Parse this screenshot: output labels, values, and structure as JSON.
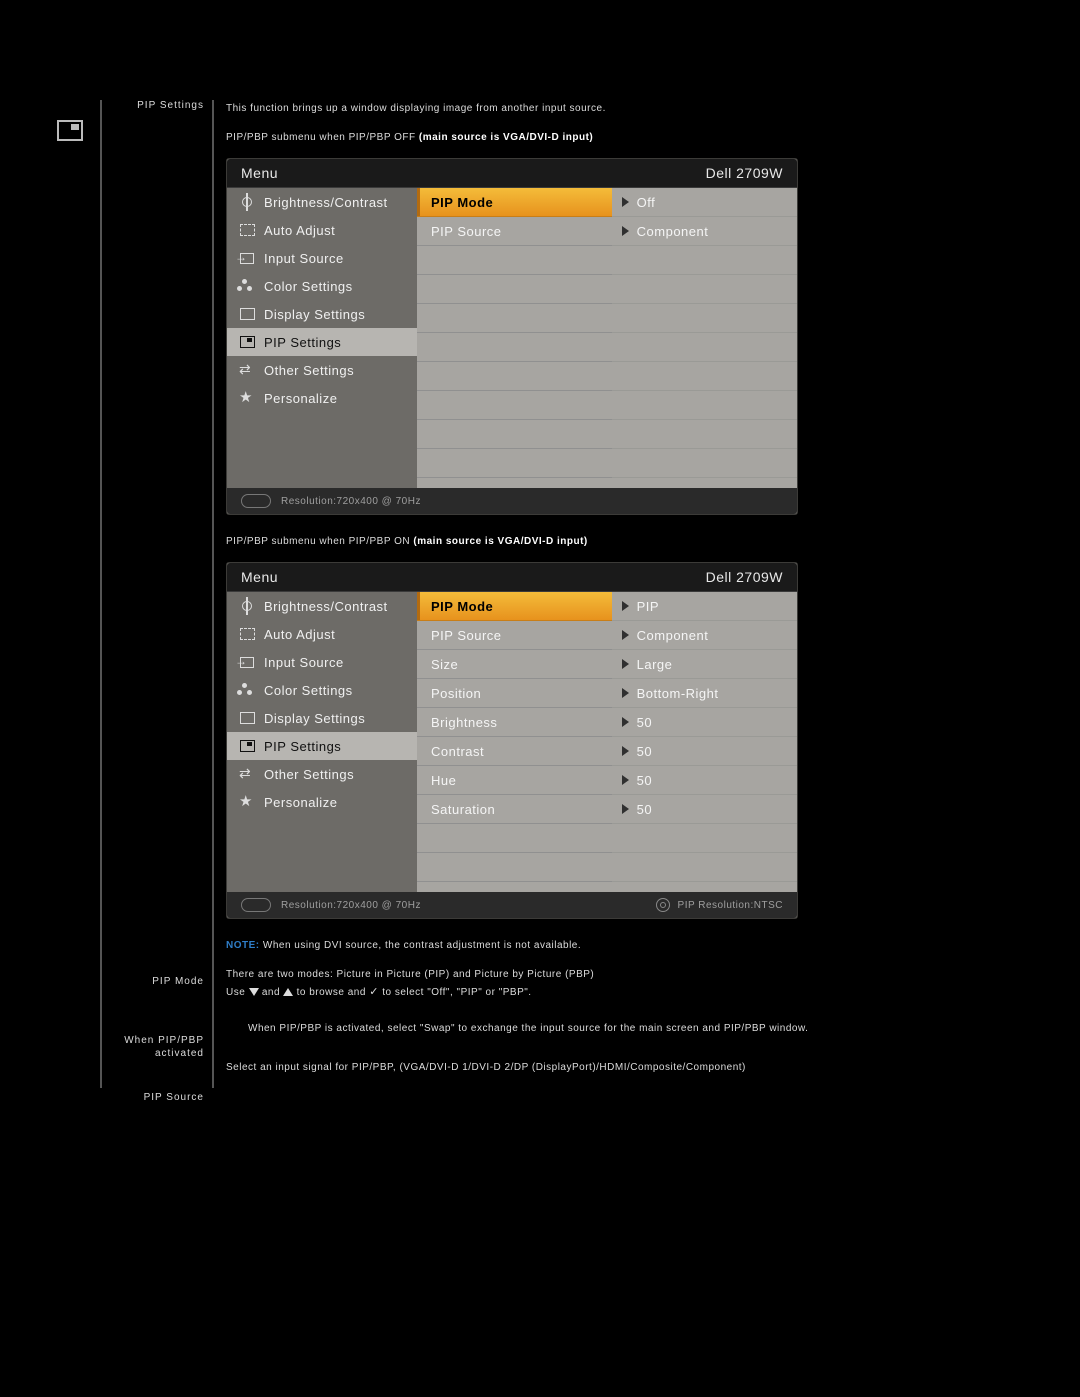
{
  "sidebar": {
    "labels": {
      "pip_settings": "PIP Settings",
      "pip_mode": "PIP Mode",
      "when_activated_l1": "When PIP/PBP",
      "when_activated_l2": "activated",
      "pip_source": "PIP Source"
    }
  },
  "text": {
    "intro": "This function brings up a window displaying image from another input source.",
    "sub1_prefix": "PIP/PBP submenu when PIP/PBP OFF ",
    "sub1_bold": "(main source is VGA/DVI-D input)",
    "sub2_prefix": "PIP/PBP submenu when PIP/PBP ON ",
    "sub2_bold": "(main source is VGA/DVI-D input)",
    "note_label": "NOTE:",
    "note_body": " When using DVI source, the contrast adjustment is not available.",
    "pip_mode_l1": "There are two modes: Picture in Picture (PIP) and Picture by Picture (PBP)",
    "pip_mode_l2a": "Use ",
    "pip_mode_l2b": " and ",
    "pip_mode_l2c": " to browse and ",
    "pip_mode_l2d": " to select \"Off\", \"PIP\" or \"PBP\".",
    "when_activated": "When PIP/PBP is activated, select \"Swap\" to exchange the input source for the main screen and PIP/PBP window.",
    "pip_source": "Select an input signal for PIP/PBP, (VGA/DVI-D 1/DVI-D 2/DP (DisplayPort)/HDMI/Composite/Component)"
  },
  "osd": {
    "menu_title": "Menu",
    "model": "Dell 2709W",
    "nav": [
      {
        "icon": "ic-brightness",
        "label": "Brightness/Contrast"
      },
      {
        "icon": "ic-auto",
        "label": "Auto Adjust"
      },
      {
        "icon": "ic-input",
        "label": "Input Source"
      },
      {
        "icon": "ic-color",
        "label": "Color Settings"
      },
      {
        "icon": "ic-display",
        "label": "Display Settings"
      },
      {
        "icon": "ic-pip",
        "label": "PIP Settings"
      },
      {
        "icon": "ic-other",
        "label": "Other Settings"
      },
      {
        "icon": "ic-star",
        "label": "Personalize"
      }
    ],
    "active_nav_index": 5,
    "status_resolution": "Resolution:720x400 @ 70Hz",
    "pip_resolution": "PIP Resolution:NTSC"
  },
  "osd1_rows": [
    {
      "setting": "PIP Mode",
      "value": "Off",
      "highlight": true
    },
    {
      "setting": "PIP Source",
      "value": "Component",
      "highlight": false
    }
  ],
  "osd2_rows": [
    {
      "setting": "PIP Mode",
      "value": "PIP",
      "highlight": true
    },
    {
      "setting": "PIP Source",
      "value": "Component",
      "highlight": false
    },
    {
      "setting": "Size",
      "value": "Large",
      "highlight": false
    },
    {
      "setting": "Position",
      "value": "Bottom-Right",
      "highlight": false
    },
    {
      "setting": "Brightness",
      "value": "50",
      "highlight": false
    },
    {
      "setting": "Contrast",
      "value": "50",
      "highlight": false
    },
    {
      "setting": "Hue",
      "value": "50",
      "highlight": false
    },
    {
      "setting": "Saturation",
      "value": "50",
      "highlight": false
    }
  ]
}
